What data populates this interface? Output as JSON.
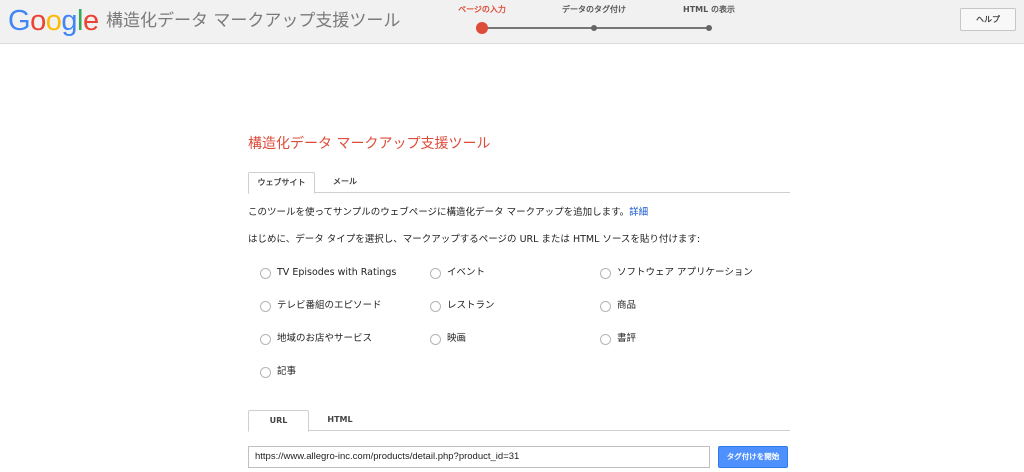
{
  "header": {
    "logo_letters": [
      {
        "ch": "G",
        "color": "#4285f4"
      },
      {
        "ch": "o",
        "color": "#ea4335"
      },
      {
        "ch": "o",
        "color": "#fbbc05"
      },
      {
        "ch": "g",
        "color": "#4285f4"
      },
      {
        "ch": "l",
        "color": "#34a853"
      },
      {
        "ch": "e",
        "color": "#ea4335"
      }
    ],
    "app_title": "構造化データ マークアップ支援ツール",
    "steps": [
      {
        "label": "ページの入力",
        "active": true
      },
      {
        "label": "データのタグ付け",
        "active": false
      },
      {
        "label": "HTML の表示",
        "active": false
      }
    ],
    "help_label": "ヘルプ"
  },
  "main": {
    "title": "構造化データ マークアップ支援ツール",
    "source_tabs": [
      {
        "label": "ウェブサイト",
        "active": true
      },
      {
        "label": "メール",
        "active": false
      }
    ],
    "intro_text": "このツールを使ってサンプルのウェブページに構造化データ マークアップを追加します。",
    "intro_link": "詳細",
    "instruction": "はじめに、データ タイプを選択し、マークアップするページの URL または HTML ソースを貼り付けます:",
    "data_types": [
      "TV Episodes with Ratings",
      "イベント",
      "ソフトウェア アプリケーション",
      "テレビ番組のエピソード",
      "レストラン",
      "商品",
      "地域のお店やサービス",
      "映画",
      "書評",
      "記事"
    ],
    "input_tabs": [
      {
        "label": "URL",
        "active": true
      },
      {
        "label": "HTML",
        "active": false
      }
    ],
    "url_value": "https://www.allegro-inc.com/products/detail.php?product_id=31",
    "start_button": "タグ付けを開始"
  },
  "colors": {
    "accent_red": "#dd4b39",
    "primary_blue": "#4d90fe",
    "link_blue": "#1155cc"
  }
}
